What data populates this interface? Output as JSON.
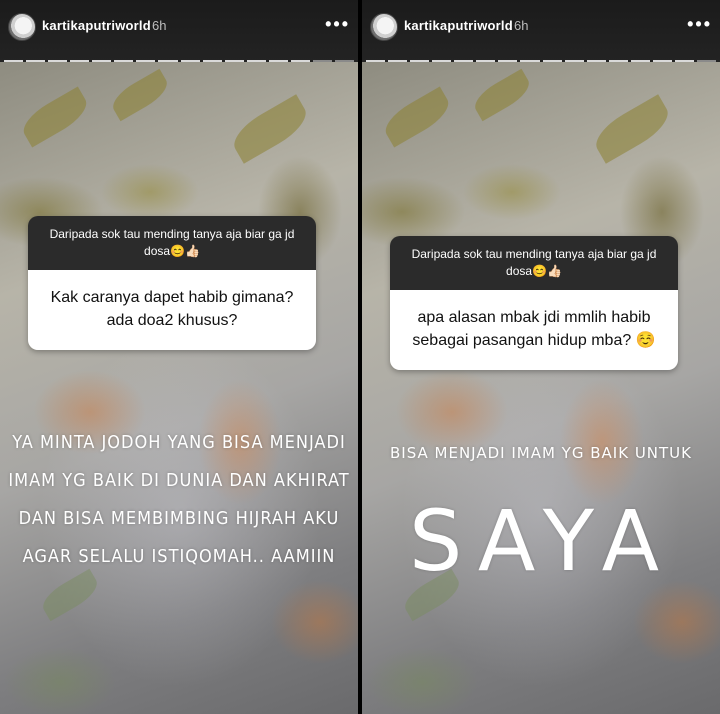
{
  "stories": [
    {
      "username": "kartikaputriworld",
      "time": "6h",
      "more_icon": "more-dots-icon",
      "question_prompt": "Daripada sok tau mending tanya aja biar ga jd dosa😊👍🏻",
      "question": "Kak caranya dapet habib gimana?ada doa2 khusus?",
      "answer": "YA MINTA JODOH YANG BISA MENJADI IMAM YG BAIK DI DUNIA DAN AKHIRAT DAN BISA MEMBIMBING HIJRAH AKU AGAR SELALU ISTIQOMAH.. AAMIIN"
    },
    {
      "username": "kartikaputriworld",
      "time": "6h",
      "more_icon": "more-dots-icon",
      "question_prompt": "Daripada sok tau mending tanya aja biar ga jd dosa😊👍🏻",
      "question": "apa alasan mbak jdi mmlih habib sebagai pasangan hidup mba? ☺️",
      "answer_small": "BISA MENJADI IMAM YG BAIK UNTUK",
      "answer_big": "SAYA"
    }
  ]
}
